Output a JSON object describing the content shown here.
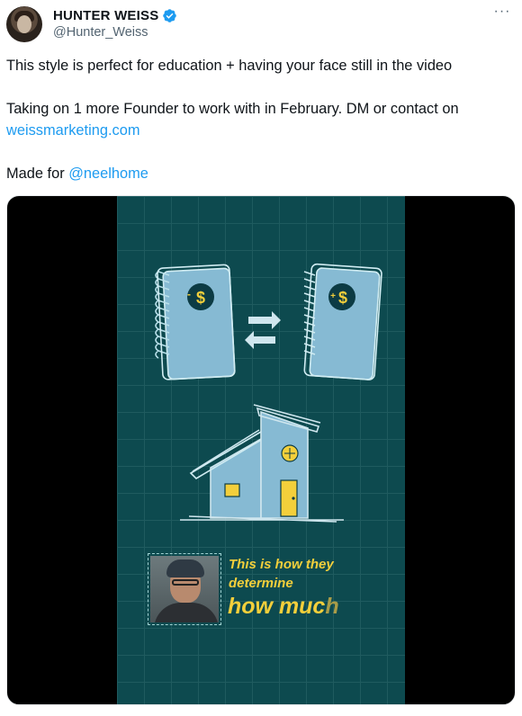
{
  "author": {
    "display_name": "HUNTER WEISS",
    "handle": "@Hunter_Weiss",
    "verified": true,
    "icons": {
      "verified": "verified-badge-icon",
      "more": "more-options-icon"
    },
    "colors": {
      "verified": "#1d9bf0"
    }
  },
  "post": {
    "line1": "This style is perfect for education + having your face still in the video",
    "line2": "Taking on 1 more Founder to work with in February. DM or contact on",
    "link_text": "weissmarketing.com",
    "line3_prefix": "Made for ",
    "mention": "@neelhome",
    "colors": {
      "link": "#1d9bf0"
    }
  },
  "video": {
    "caption_line1": "This is how they",
    "caption_line2": "determine",
    "caption_big": "how muc",
    "caption_big_fade": "h",
    "colors": {
      "background": "#0d4a4f",
      "accent": "#f3cf3b",
      "sketch": "#a9d4e0"
    }
  }
}
